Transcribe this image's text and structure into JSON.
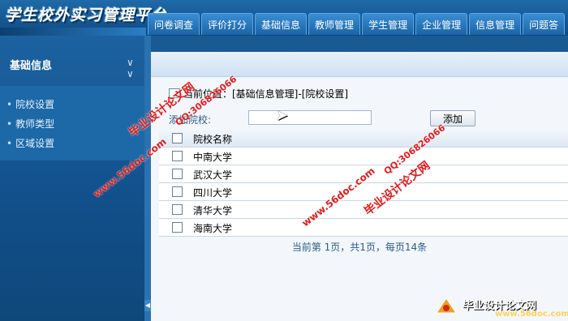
{
  "app": {
    "logo_text": "学生校外实习管理平台"
  },
  "nav": {
    "tabs": [
      "问卷调查",
      "评价打分",
      "基础信息",
      "教师管理",
      "学生管理",
      "企业管理",
      "信息管理",
      "问题答"
    ]
  },
  "sidebar": {
    "title": "基础信息",
    "toggle_icon": "chevron-down-icon",
    "items": [
      {
        "label": "院校设置"
      },
      {
        "label": "教师类型"
      },
      {
        "label": "区域设置"
      }
    ]
  },
  "main": {
    "breadcrumb": "当前位置：[基础信息管理]-[院校设置]",
    "add_label": "添加院校:",
    "add_input_value": "",
    "add_button": "添加",
    "table": {
      "header": "院校名称",
      "rows": [
        "中南大学",
        "武汉大学",
        "四川大学",
        "清华大学",
        "海南大学"
      ]
    },
    "pager": "当前第 1页，共1页，每页14条"
  },
  "watermarks": {
    "qq": "QQ:306826066",
    "site_name": "毕业设计论文网",
    "url": "www.56doc.com"
  }
}
